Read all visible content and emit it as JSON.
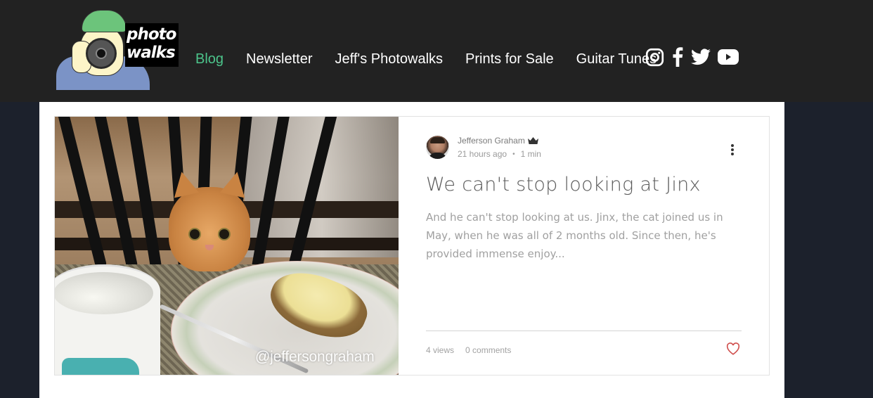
{
  "header": {
    "logo": {
      "line1": "photo",
      "line2": "walks"
    },
    "nav": [
      {
        "label": "Blog",
        "active": true
      },
      {
        "label": "Newsletter",
        "active": false
      },
      {
        "label": "Jeff's Photowalks",
        "active": false
      },
      {
        "label": "Prints for Sale",
        "active": false
      },
      {
        "label": "Guitar Tunes",
        "active": false
      }
    ],
    "social": [
      "instagram-icon",
      "facebook-icon",
      "twitter-icon",
      "youtube-icon"
    ]
  },
  "post": {
    "image_watermark": "@jeffersongraham",
    "author": "Jefferson Graham",
    "author_badge": "crown-icon",
    "time_ago": "21 hours ago",
    "separator": "•",
    "read_time": "1 min",
    "title": "We can't stop looking at Jinx",
    "excerpt": "And he can't stop looking at us. Jinx, the cat joined us in May, when he was all of 2 months old. Since then, he's provided immense enjoy...",
    "views": "4 views",
    "comments": "0 comments",
    "liked": false
  },
  "colors": {
    "header_bg": "#222222",
    "page_bg": "#1c212c",
    "nav_active": "#4cc48b",
    "like_heart": "#d0504e"
  }
}
